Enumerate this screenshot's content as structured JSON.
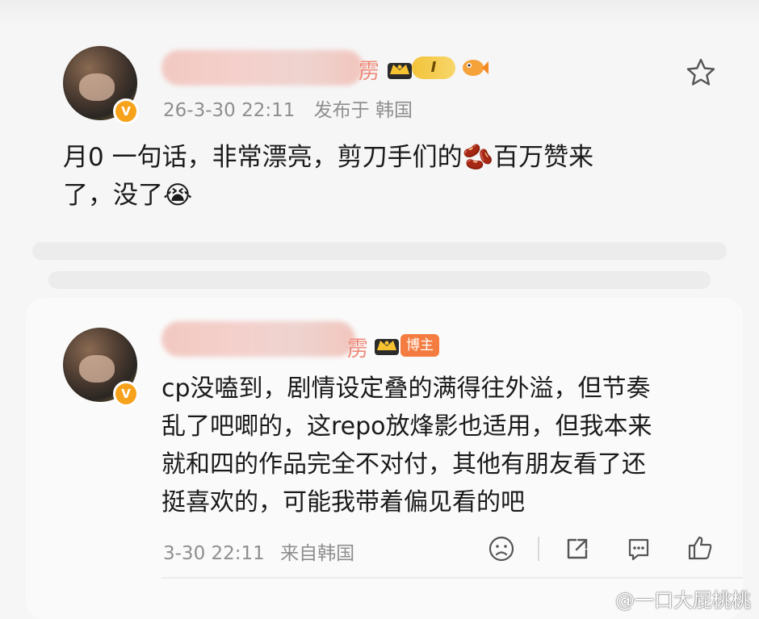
{
  "post": {
    "author_tail": "雳",
    "level_badge": "I",
    "timestamp": "26-3-30 22:11",
    "source": "发布于 韩国",
    "content_line1": "月0 一句话，非常漂亮，剪刀手们的🫘百万赞来",
    "content_line2": "了，没了😭"
  },
  "reply": {
    "author_tail": "雳",
    "role_badge": "博主",
    "content_lines": [
      "cp没嗑到，剧情设定叠的满得往外溢，但节奏",
      "乱了吧唧的，这repo放烽影也适用，但我本来",
      "就和四的作品完全不对付，其他有朋友看了还",
      "挺喜欢的，可能我带着偏见看的吧"
    ],
    "timestamp": "3-30 22:11",
    "source": "来自韩国"
  },
  "icons": {
    "favorite": "star-outline-icon",
    "dislike": "sad-face-icon",
    "share": "share-icon",
    "comment": "comment-icon",
    "like": "thumbs-up-icon",
    "verified": "verified-v-icon"
  },
  "colors": {
    "accent_orange": "#f7a21b",
    "boz_badge": "#f47c40",
    "meta_gray": "#8e8e8e"
  },
  "watermark": "@一口大屁桃桃"
}
